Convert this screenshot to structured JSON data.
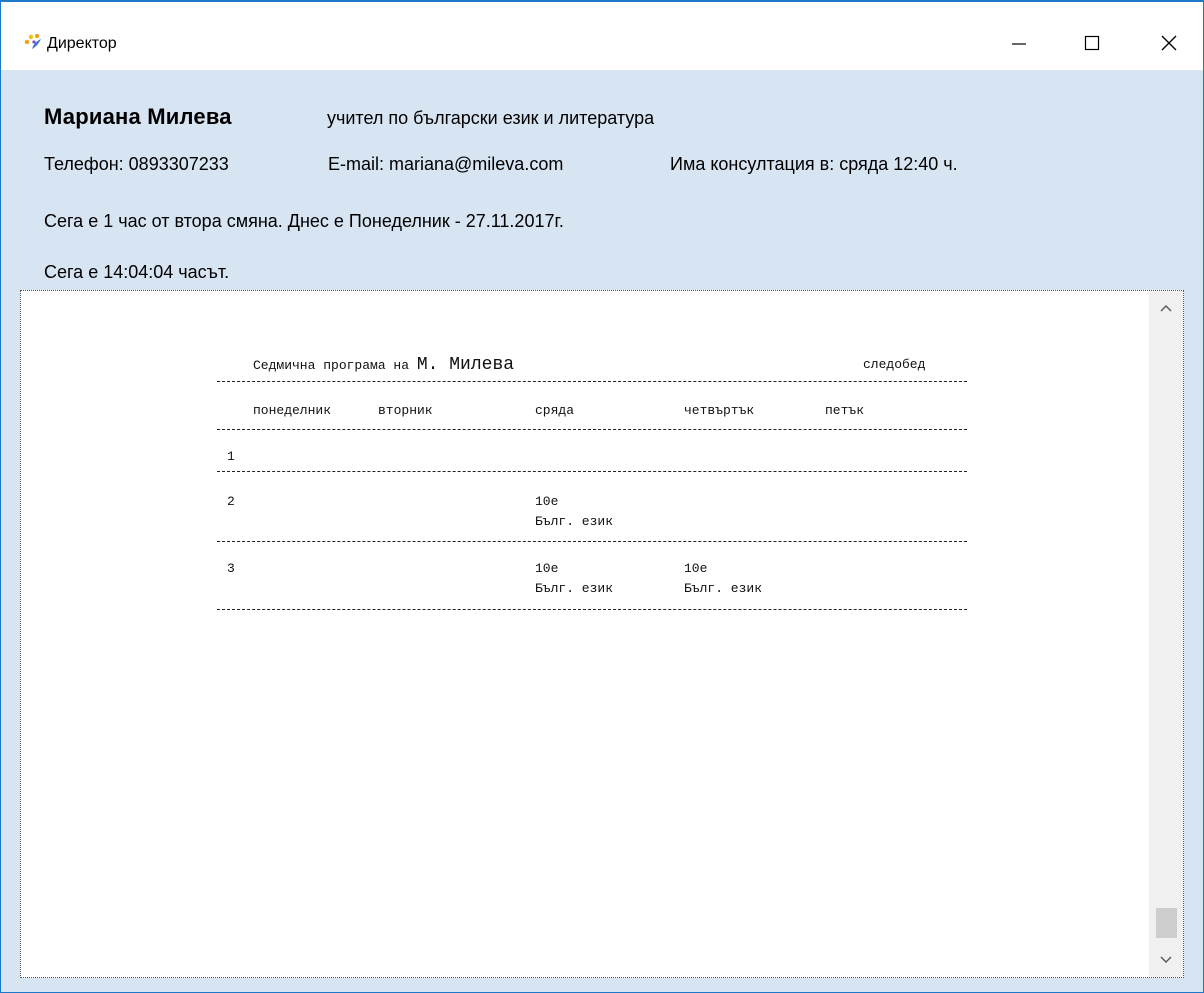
{
  "window": {
    "title": "Директор",
    "icon": "app-logo-icon",
    "controls": {
      "minimize": "minimize-icon",
      "maximize": "maximize-icon",
      "close": "close-icon"
    }
  },
  "teacher": {
    "name": "Мариана Милева",
    "role": "учител по български език и литература",
    "phone": "Телефон: 0893307233",
    "email": "E-mail: mariana@mileva.com",
    "consultation": "Има консултация в: сряда 12:40 ч."
  },
  "status": {
    "period_line": "Сега е 1 час от  втора смяна. Днес е Понеделник - 27.11.2017г.",
    "time_line": "Сега е 14:04:04 часът."
  },
  "schedule": {
    "title_prefix": "Седмична програма на ",
    "title_name": "М. Милева",
    "shift": "следобед",
    "days": [
      "понеделник",
      "вторник",
      "сряда",
      "четвъртък",
      "петък"
    ],
    "rows": [
      {
        "period": "1",
        "entries": []
      },
      {
        "period": "2",
        "entries": [
          {
            "day": "сряда",
            "class": "10е",
            "subject": "Бълг. език"
          }
        ]
      },
      {
        "period": "3",
        "entries": [
          {
            "day": "сряда",
            "class": "10е",
            "subject": "Бълг. език"
          },
          {
            "day": "четвъртък",
            "class": "10е",
            "subject": "Бълг. език"
          }
        ]
      }
    ]
  }
}
